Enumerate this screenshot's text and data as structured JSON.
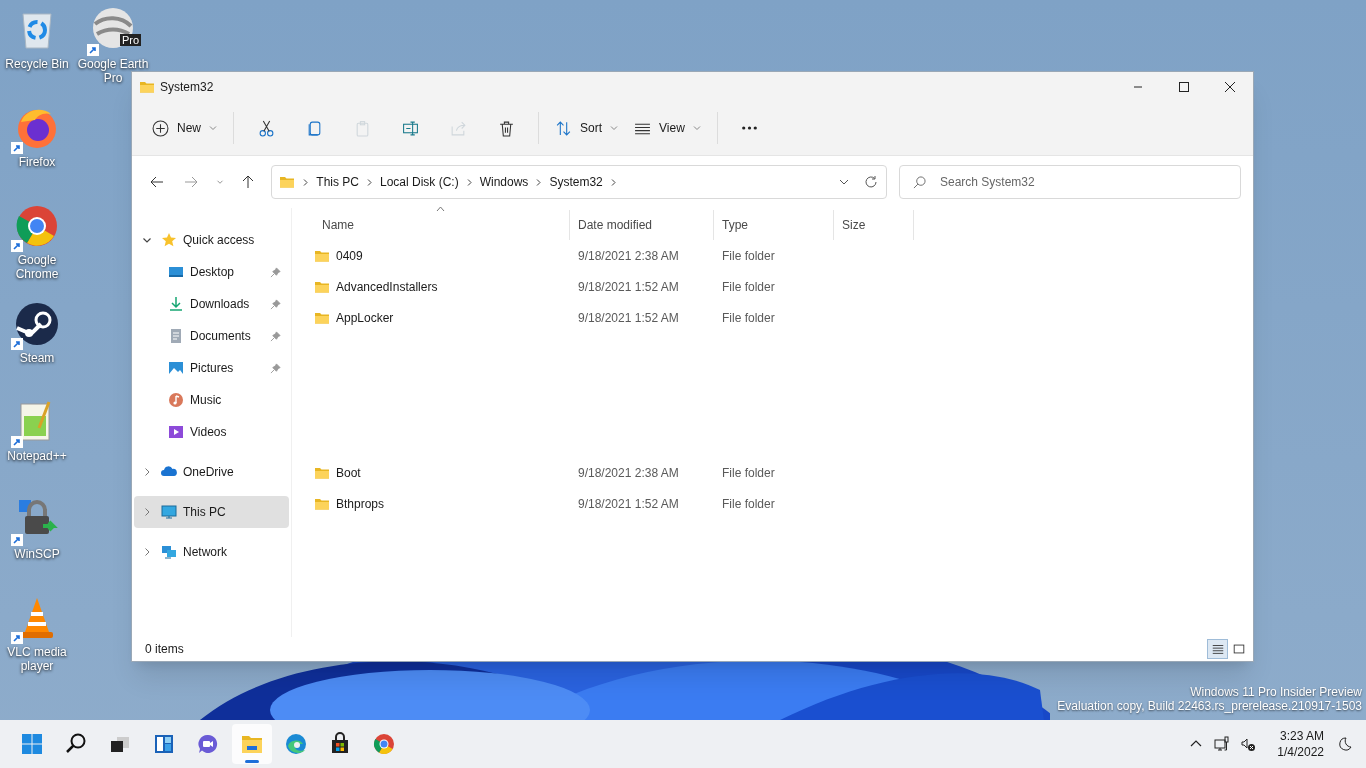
{
  "desktop_icons": [
    {
      "kind": "recycle-bin",
      "label": "Recycle Bin",
      "shortcut": false
    },
    {
      "kind": "earth",
      "label": "Google Earth Pro",
      "badge": "Pro",
      "shortcut": true
    },
    {
      "kind": "firefox",
      "label": "Firefox",
      "shortcut": true
    },
    {
      "kind": "chrome",
      "label": "Google Chrome",
      "shortcut": true
    },
    {
      "kind": "steam",
      "label": "Steam",
      "shortcut": true
    },
    {
      "kind": "notepad",
      "label": "Notepad++",
      "shortcut": true
    },
    {
      "kind": "winscp",
      "label": "WinSCP",
      "shortcut": true
    },
    {
      "kind": "vlc",
      "label": "VLC media player",
      "shortcut": true
    }
  ],
  "window": {
    "title": "System32",
    "toolbar": [
      {
        "kind": "new",
        "label": "New",
        "disabled": false
      },
      {
        "kind": "separator"
      },
      {
        "kind": "cut",
        "disabled": false
      },
      {
        "kind": "copy",
        "disabled": false
      },
      {
        "kind": "paste",
        "disabled": true
      },
      {
        "kind": "rename",
        "disabled": false
      },
      {
        "kind": "share",
        "disabled": true
      },
      {
        "kind": "delete",
        "disabled": false
      },
      {
        "kind": "separator"
      },
      {
        "kind": "sort",
        "label": "Sort",
        "disabled": false
      },
      {
        "kind": "view",
        "label": "View",
        "disabled": false
      },
      {
        "kind": "separator"
      },
      {
        "kind": "more",
        "disabled": false
      }
    ],
    "address": {
      "crumbs": [
        "This PC",
        "Local Disk (C:)",
        "Windows",
        "System32"
      ]
    },
    "search": {
      "placeholder": "Search System32"
    },
    "nav": [
      {
        "label": "Quick access",
        "kind": "star",
        "expanded": true,
        "selected": false,
        "children": [
          {
            "label": "Desktop",
            "kind": "desktop",
            "pinned": true,
            "selected": false
          },
          {
            "label": "Downloads",
            "kind": "downloads",
            "pinned": true,
            "selected": false
          },
          {
            "label": "Documents",
            "kind": "documents",
            "pinned": true,
            "selected": false
          },
          {
            "label": "Pictures",
            "kind": "pictures",
            "pinned": true,
            "selected": false
          },
          {
            "label": "Music",
            "kind": "music",
            "pinned": false,
            "selected": false
          },
          {
            "label": "Videos",
            "kind": "videos",
            "pinned": false,
            "selected": false
          }
        ]
      },
      {
        "label": "OneDrive",
        "kind": "cloud",
        "expanded": false,
        "selected": false
      },
      {
        "label": "This PC",
        "kind": "pc",
        "expanded": false,
        "selected": true
      },
      {
        "label": "Network",
        "kind": "network",
        "expanded": false,
        "selected": false
      }
    ],
    "table": {
      "columns": [
        {
          "label": "Name",
          "sorted": true
        },
        {
          "label": "Date modified",
          "sorted": false
        },
        {
          "label": "Type",
          "sorted": false
        },
        {
          "label": "Size",
          "sorted": false
        }
      ],
      "row_groups": [
        [
          {
            "name": "0409",
            "date": "9/18/2021 2:38 AM",
            "type": "File folder"
          },
          {
            "name": "AdvancedInstallers",
            "date": "9/18/2021 1:52 AM",
            "type": "File folder"
          },
          {
            "name": "AppLocker",
            "date": "9/18/2021 1:52 AM",
            "type": "File folder"
          }
        ],
        [
          {
            "name": "Boot",
            "date": "9/18/2021 2:38 AM",
            "type": "File folder"
          },
          {
            "name": "Bthprops",
            "date": "9/18/2021 1:52 AM",
            "type": "File folder"
          }
        ]
      ]
    },
    "status_bar": {
      "text": "0 items",
      "views": [
        {
          "kind": "details",
          "selected": true
        },
        {
          "kind": "tiles",
          "selected": false
        }
      ]
    }
  },
  "system_notice": [
    "Windows 11 Pro Insider Preview",
    "Evaluation copy, Build 22463.rs_prerelease.210917-1503"
  ],
  "taskbar": {
    "apps": [
      {
        "kind": "start",
        "selected": false
      },
      {
        "kind": "search",
        "selected": false
      },
      {
        "kind": "task-view",
        "selected": false
      },
      {
        "kind": "widgets",
        "selected": false
      },
      {
        "kind": "chat",
        "selected": false
      },
      {
        "kind": "explorer",
        "selected": true
      },
      {
        "kind": "edge",
        "selected": false
      },
      {
        "kind": "store",
        "selected": false
      },
      {
        "kind": "chrome",
        "selected": false
      }
    ],
    "time": "3:23 AM",
    "date": "1/4/2022"
  }
}
